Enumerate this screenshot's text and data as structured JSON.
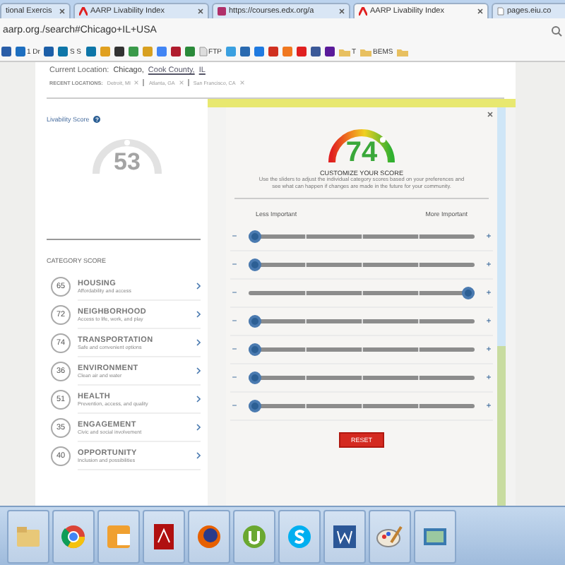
{
  "browser": {
    "tabs": [
      {
        "title": "tional Exercis",
        "selected": false,
        "kind": "plain"
      },
      {
        "title": "AARP Livability Index",
        "selected": false,
        "kind": "site"
      },
      {
        "title": "https://courses.edx.org/a",
        "selected": false,
        "kind": "course"
      },
      {
        "title": "AARP Livability Index",
        "selected": true,
        "kind": "site"
      },
      {
        "title": "pages.eiu.co",
        "selected": false,
        "kind": "page"
      }
    ],
    "address": "aarp.org./search#Chicago+IL+USA",
    "bookmarks": [
      {
        "kind": "app",
        "color": "#2a5ea8"
      },
      {
        "kind": "app",
        "color": "#1e6fc0",
        "label": "1 Dr"
      },
      {
        "kind": "app",
        "color": "#1d5fa8"
      },
      {
        "kind": "app",
        "color": "#0e76a8",
        "label": "S S"
      },
      {
        "kind": "app",
        "color": "#0e76a8"
      },
      {
        "kind": "app",
        "color": "#e0a020"
      },
      {
        "kind": "app",
        "color": "#333333"
      },
      {
        "kind": "app",
        "color": "#3a9a4a"
      },
      {
        "kind": "app",
        "color": "#d8a020"
      },
      {
        "kind": "app",
        "color": "#4285f4"
      },
      {
        "kind": "app",
        "color": "#b01c2e"
      },
      {
        "kind": "app",
        "color": "#2a8a3a"
      },
      {
        "kind": "page",
        "color": "#dddddd",
        "label": "FTP"
      },
      {
        "kind": "app",
        "color": "#3aa0e0"
      },
      {
        "kind": "app",
        "color": "#2a6ab0"
      },
      {
        "kind": "app",
        "color": "#1f7ae0"
      },
      {
        "kind": "app",
        "color": "#d03020"
      },
      {
        "kind": "app",
        "color": "#f07820"
      },
      {
        "kind": "app",
        "color": "#e02020"
      },
      {
        "kind": "app",
        "color": "#3b5998"
      },
      {
        "kind": "app",
        "color": "#5a1a9a"
      },
      {
        "kind": "folder",
        "color": "#e8c060",
        "label": "T"
      },
      {
        "kind": "folder",
        "color": "#e8c060",
        "label": "BEMS"
      },
      {
        "kind": "folder",
        "color": "#e8c060"
      }
    ]
  },
  "location": {
    "label": "Current Location:",
    "city": "Chicago,",
    "county": "Cook County,",
    "state": "IL"
  },
  "recent": {
    "label": "RECENT LOCATIONS:",
    "items": [
      "Detroit, MI",
      "Atlanta, GA",
      "San Francisco, CA"
    ]
  },
  "score": {
    "label": "Livability Score",
    "help": "?",
    "value": "53"
  },
  "categories": {
    "heading": "CATEGORY SCORE",
    "items": [
      {
        "score": "65",
        "name": "HOUSING",
        "desc": "Affordability and access"
      },
      {
        "score": "72",
        "name": "NEIGHBORHOOD",
        "desc": "Access to life, work, and play"
      },
      {
        "score": "74",
        "name": "TRANSPORTATION",
        "desc": "Safe and convenient options"
      },
      {
        "score": "36",
        "name": "ENVIRONMENT",
        "desc": "Clean air and water"
      },
      {
        "score": "51",
        "name": "HEALTH",
        "desc": "Prevention, access, and quality"
      },
      {
        "score": "35",
        "name": "ENGAGEMENT",
        "desc": "Civic and social involvement"
      },
      {
        "score": "40",
        "name": "OPPORTUNITY",
        "desc": "Inclusion and possibilities"
      }
    ]
  },
  "modal": {
    "score": "74",
    "title": "CUSTOMIZE YOUR SCORE",
    "text": "Use the sliders to adjust the individual category scores based on your preferences and see what can happen if changes are made in the future for your community.",
    "less": "Less Important",
    "more": "More Important",
    "minus": "−",
    "plus": "+",
    "sliders": [
      {
        "level": 0
      },
      {
        "level": 0
      },
      {
        "level": 1
      },
      {
        "level": 0
      },
      {
        "level": 0
      },
      {
        "level": 0
      },
      {
        "level": 0
      }
    ],
    "reset": "RESET"
  }
}
